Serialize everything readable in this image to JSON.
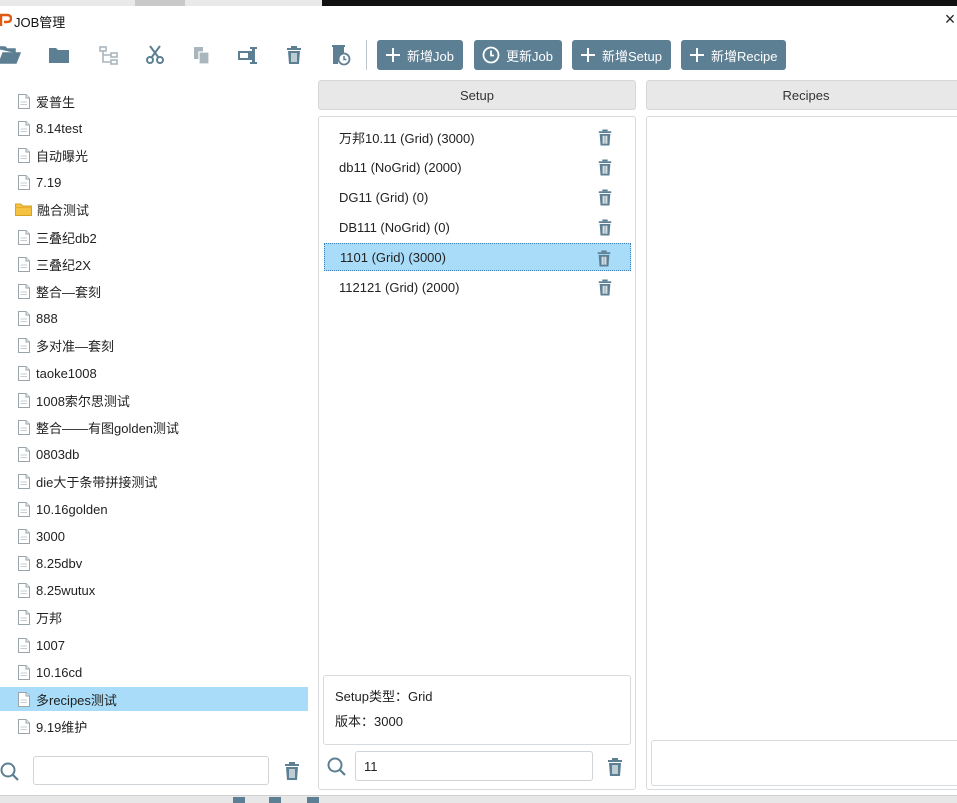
{
  "window": {
    "title": "JOB管理",
    "close_glyph": "×"
  },
  "toolbar": {
    "icons": [
      "open-folder-icon",
      "folder-icon",
      "tree-structure-icon",
      "cut-icon",
      "copy-icon",
      "rename-icon",
      "delete-icon",
      "history-icon"
    ],
    "buttons": {
      "new_job": "新增Job",
      "update_job": "更新Job",
      "new_setup": "新增Setup",
      "new_recipe": "新增Recipe"
    }
  },
  "job_tree": {
    "items": [
      {
        "label": "爱普生",
        "type": "file"
      },
      {
        "label": "8.14test",
        "type": "file"
      },
      {
        "label": "自动曝光",
        "type": "file"
      },
      {
        "label": "7.19",
        "type": "file"
      },
      {
        "label": "融合测试",
        "type": "folder"
      },
      {
        "label": "三叠纪db2",
        "type": "file"
      },
      {
        "label": "三叠纪2X",
        "type": "file"
      },
      {
        "label": "整合—套刻",
        "type": "file"
      },
      {
        "label": "888",
        "type": "file"
      },
      {
        "label": "多对准—套刻",
        "type": "file"
      },
      {
        "label": "taoke1008",
        "type": "file"
      },
      {
        "label": "1008索尔思测试",
        "type": "file"
      },
      {
        "label": "整合——有图golden测试",
        "type": "file"
      },
      {
        "label": "0803db",
        "type": "file"
      },
      {
        "label": "die大于条带拼接测试",
        "type": "file"
      },
      {
        "label": "10.16golden",
        "type": "file"
      },
      {
        "label": "3000",
        "type": "file"
      },
      {
        "label": "8.25dbv",
        "type": "file"
      },
      {
        "label": "8.25wutux",
        "type": "file"
      },
      {
        "label": "万邦",
        "type": "file"
      },
      {
        "label": "1007",
        "type": "file"
      },
      {
        "label": "10.16cd",
        "type": "file"
      },
      {
        "label": "多recipes测试",
        "type": "file",
        "selected": true
      },
      {
        "label": "9.19维护",
        "type": "file"
      }
    ],
    "search_value": ""
  },
  "setup_panel": {
    "header": "Setup",
    "items": [
      {
        "label": "万邦10.11 (Grid) (3000)"
      },
      {
        "label": "db11 (NoGrid) (2000)"
      },
      {
        "label": "DG11 (Grid) (0)"
      },
      {
        "label": "DB111 (NoGrid) (0)"
      },
      {
        "label": "1101 (Grid) (3000)",
        "selected": true
      },
      {
        "label": "112121 (Grid) (2000)"
      }
    ],
    "info": {
      "type_line": "Setup类型：Grid",
      "version_line": "版本：3000"
    },
    "search_value": "11"
  },
  "recipes_panel": {
    "header": "Recipes",
    "input_value": ""
  },
  "colors": {
    "accent_button": "#5d7f93",
    "selection": "#a8dcf8",
    "icon": "#5d7f93"
  }
}
